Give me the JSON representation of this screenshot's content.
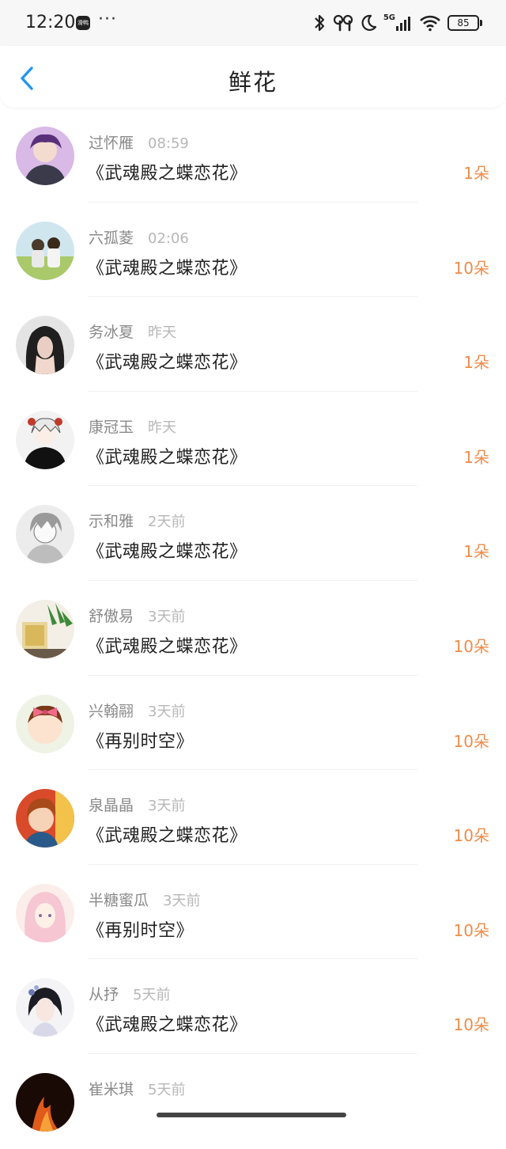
{
  "status_bar": {
    "time": "12:20",
    "app_badge": "滑鸭",
    "dots": "···",
    "network": "5G",
    "battery": "85"
  },
  "header": {
    "title": "鲜花",
    "back_icon": "chevron-left-icon",
    "accent": "#2196F3"
  },
  "list": [
    {
      "name": "过怀雁",
      "time": "08:59",
      "book": "《武魂殿之蝶恋花》",
      "count": "1朵",
      "avatar": "a1"
    },
    {
      "name": "六孤菱",
      "time": "02:06",
      "book": "《武魂殿之蝶恋花》",
      "count": "10朵",
      "avatar": "a2"
    },
    {
      "name": "务冰夏",
      "time": "昨天",
      "book": "《武魂殿之蝶恋花》",
      "count": "1朵",
      "avatar": "a3"
    },
    {
      "name": "康冠玉",
      "time": "昨天",
      "book": "《武魂殿之蝶恋花》",
      "count": "1朵",
      "avatar": "a4"
    },
    {
      "name": "示和雅",
      "time": "2天前",
      "book": "《武魂殿之蝶恋花》",
      "count": "1朵",
      "avatar": "a5"
    },
    {
      "name": "舒傲易",
      "time": "3天前",
      "book": "《武魂殿之蝶恋花》",
      "count": "10朵",
      "avatar": "a6"
    },
    {
      "name": "兴翰翮",
      "time": "3天前",
      "book": "《再别时空》",
      "count": "10朵",
      "avatar": "a7"
    },
    {
      "name": "泉晶晶",
      "time": "3天前",
      "book": "《武魂殿之蝶恋花》",
      "count": "10朵",
      "avatar": "a8"
    },
    {
      "name": "半糖蜜瓜",
      "time": "3天前",
      "book": "《再别时空》",
      "count": "10朵",
      "avatar": "a9"
    },
    {
      "name": "从抒",
      "time": "5天前",
      "book": "《武魂殿之蝶恋花》",
      "count": "10朵",
      "avatar": "a10"
    },
    {
      "name": "崔米琪",
      "time": "5天前",
      "book": "",
      "count": "",
      "avatar": "a11"
    }
  ],
  "colors": {
    "count": "#ee8c4a",
    "name": "#8a8a8a",
    "time": "#b7b7b7"
  }
}
